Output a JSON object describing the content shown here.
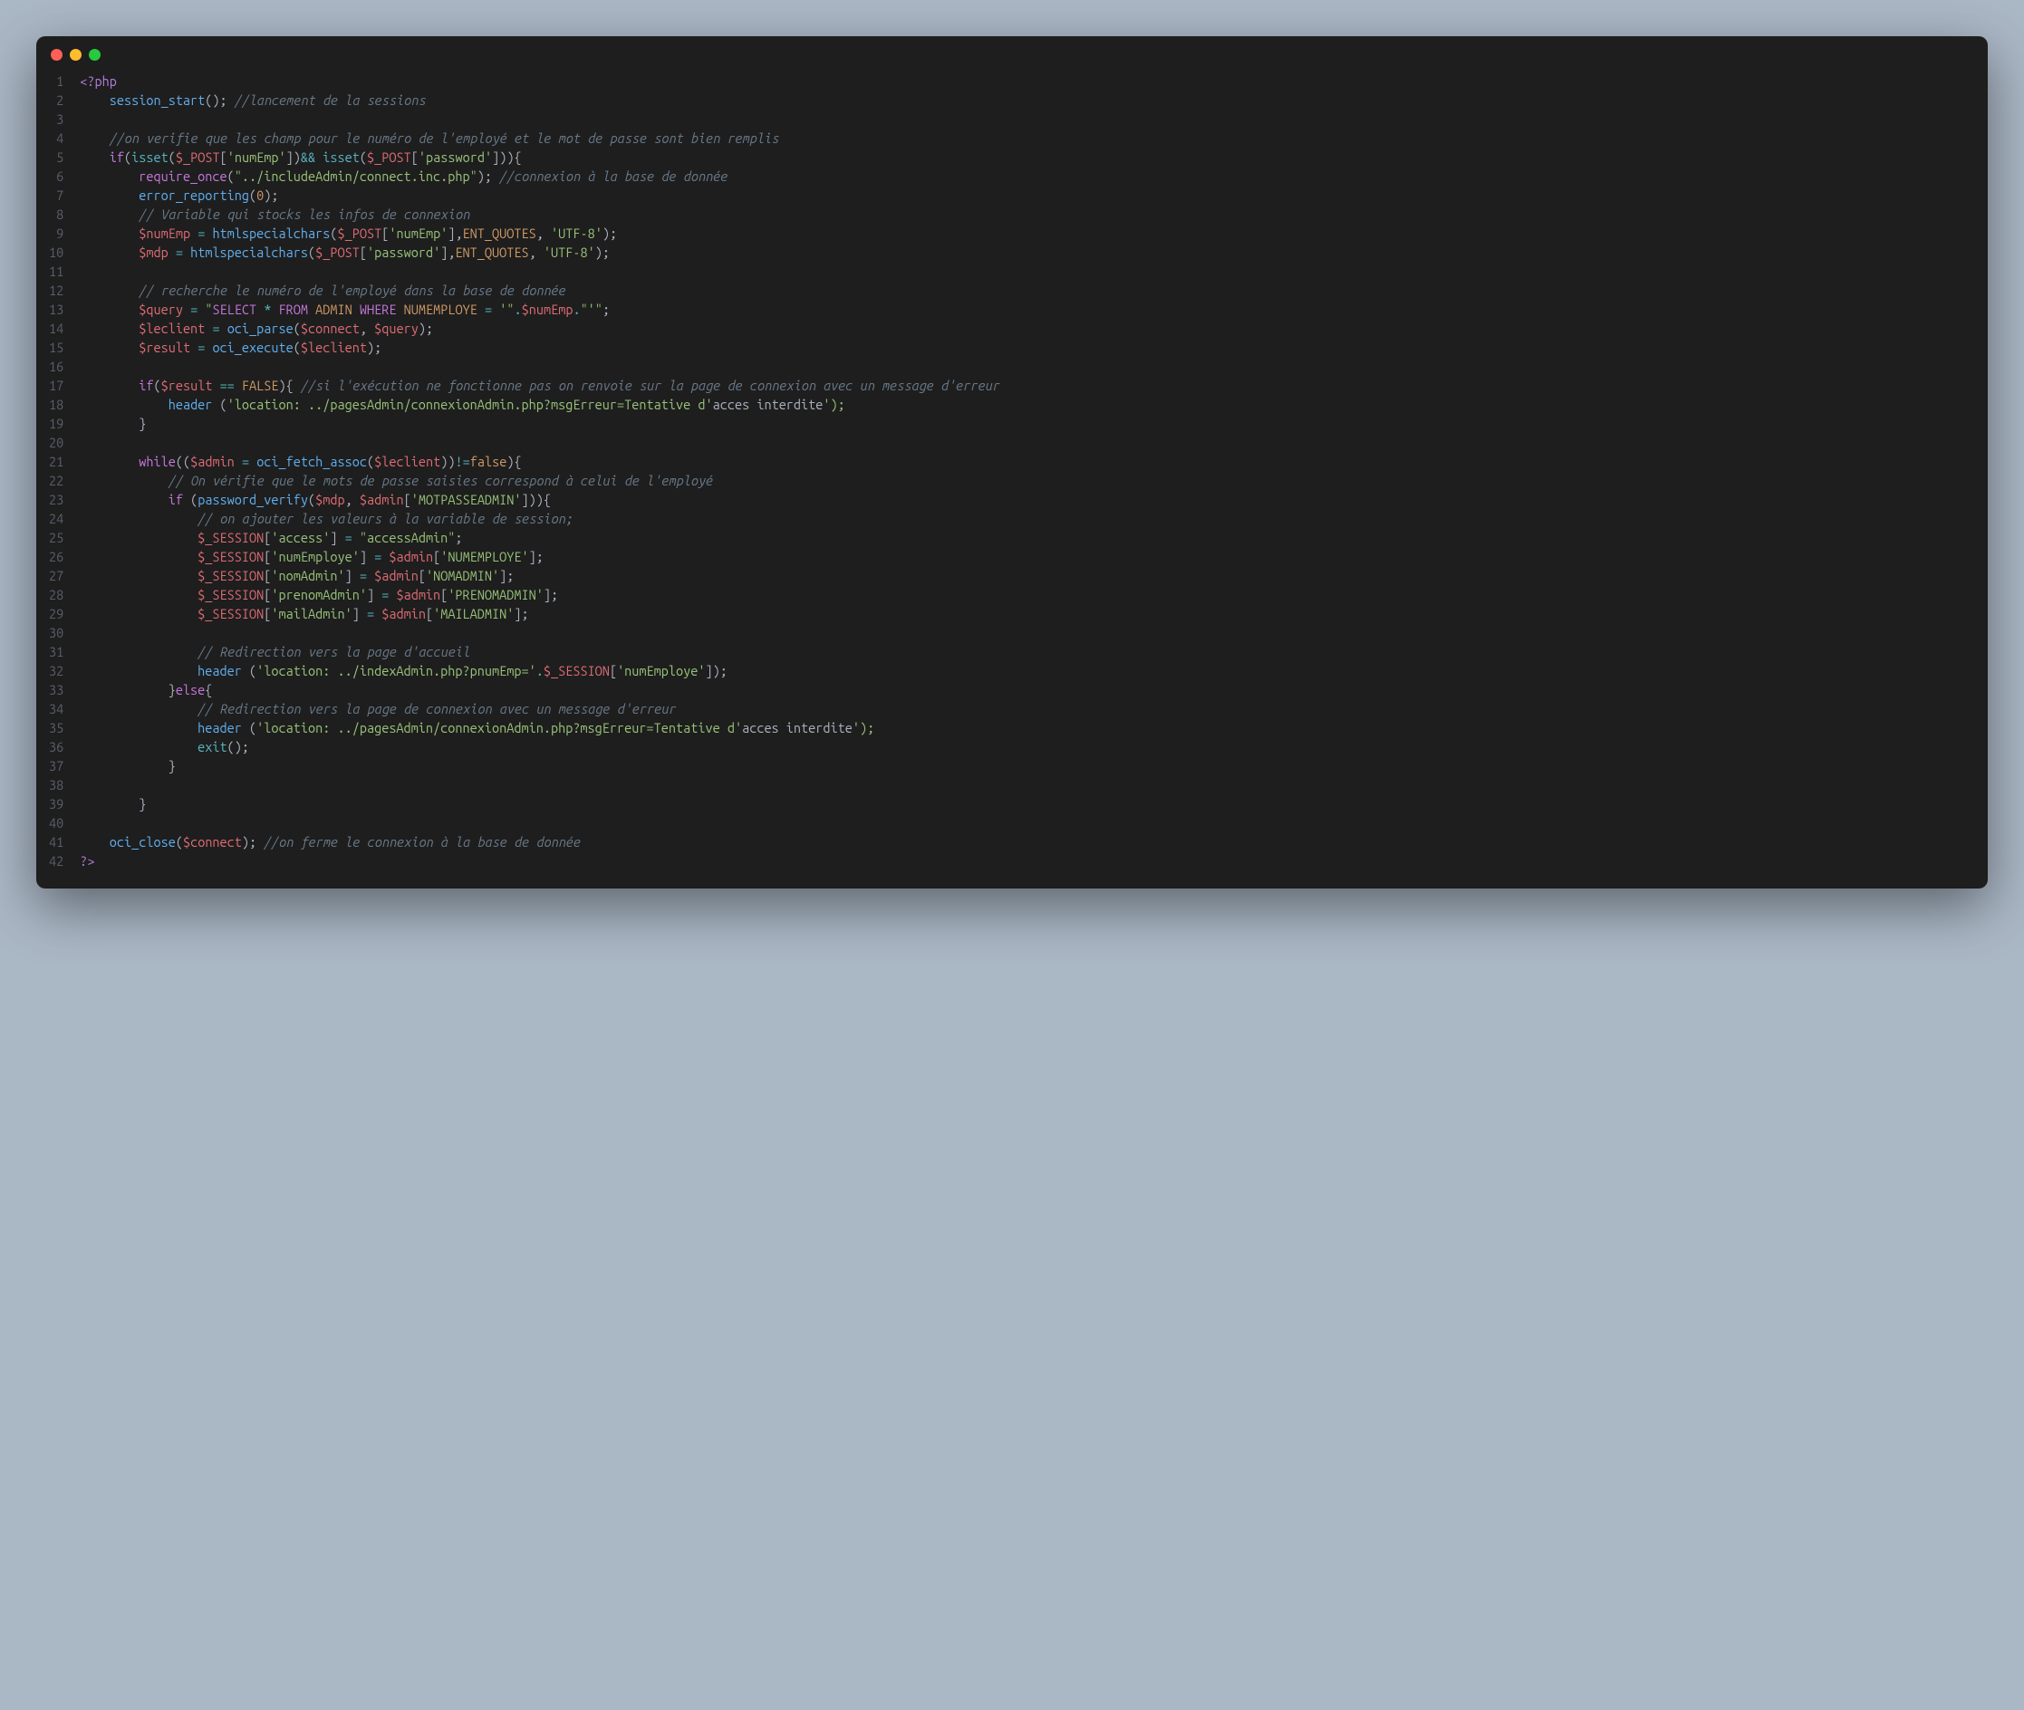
{
  "window": {
    "dot_colors": {
      "red": "#ff5f56",
      "yellow": "#ffbd2e",
      "green": "#27c93f"
    }
  },
  "code": {
    "line_count": 42,
    "tokens": [
      [
        [
          "c-tag",
          "<?php"
        ]
      ],
      [
        [
          "c-punc",
          "    "
        ],
        [
          "c-func",
          "session_start"
        ],
        [
          "c-punc",
          "(); "
        ],
        [
          "c-comment",
          "//lancement de la sessions"
        ]
      ],
      [],
      [
        [
          "c-punc",
          "    "
        ],
        [
          "c-comment",
          "//on verifie que les champ pour le numéro de l'employé et le mot de passe sont bien remplis"
        ]
      ],
      [
        [
          "c-punc",
          "    "
        ],
        [
          "c-keyword",
          "if"
        ],
        [
          "c-punc",
          "("
        ],
        [
          "c-builtin",
          "isset"
        ],
        [
          "c-punc",
          "("
        ],
        [
          "c-var",
          "$_POST"
        ],
        [
          "c-punc",
          "["
        ],
        [
          "c-str",
          "'numEmp'"
        ],
        [
          "c-punc",
          "])"
        ],
        [
          "c-op",
          "&&"
        ],
        [
          "c-punc",
          " "
        ],
        [
          "c-builtin",
          "isset"
        ],
        [
          "c-punc",
          "("
        ],
        [
          "c-var",
          "$_POST"
        ],
        [
          "c-punc",
          "["
        ],
        [
          "c-str",
          "'password'"
        ],
        [
          "c-punc",
          "])){"
        ]
      ],
      [
        [
          "c-punc",
          "        "
        ],
        [
          "c-keyword",
          "require_once"
        ],
        [
          "c-punc",
          "("
        ],
        [
          "c-str",
          "\"../includeAdmin/connect.inc.php\""
        ],
        [
          "c-punc",
          "); "
        ],
        [
          "c-comment",
          "//connexion à la base de donnée"
        ]
      ],
      [
        [
          "c-punc",
          "        "
        ],
        [
          "c-func",
          "error_reporting"
        ],
        [
          "c-punc",
          "("
        ],
        [
          "c-const",
          "0"
        ],
        [
          "c-punc",
          ");"
        ]
      ],
      [
        [
          "c-punc",
          "        "
        ],
        [
          "c-comment",
          "// Variable qui stocks les infos de connexion"
        ]
      ],
      [
        [
          "c-punc",
          "        "
        ],
        [
          "c-var",
          "$numEmp"
        ],
        [
          "c-punc",
          " "
        ],
        [
          "c-op",
          "="
        ],
        [
          "c-punc",
          " "
        ],
        [
          "c-func",
          "htmlspecialchars"
        ],
        [
          "c-punc",
          "("
        ],
        [
          "c-var",
          "$_POST"
        ],
        [
          "c-punc",
          "["
        ],
        [
          "c-str",
          "'numEmp'"
        ],
        [
          "c-punc",
          "],"
        ],
        [
          "c-const",
          "ENT_QUOTES"
        ],
        [
          "c-punc",
          ", "
        ],
        [
          "c-str",
          "'UTF-8'"
        ],
        [
          "c-punc",
          ");"
        ]
      ],
      [
        [
          "c-punc",
          "        "
        ],
        [
          "c-var",
          "$mdp"
        ],
        [
          "c-punc",
          " "
        ],
        [
          "c-op",
          "="
        ],
        [
          "c-punc",
          " "
        ],
        [
          "c-func",
          "htmlspecialchars"
        ],
        [
          "c-punc",
          "("
        ],
        [
          "c-var",
          "$_POST"
        ],
        [
          "c-punc",
          "["
        ],
        [
          "c-str",
          "'password'"
        ],
        [
          "c-punc",
          "],"
        ],
        [
          "c-const",
          "ENT_QUOTES"
        ],
        [
          "c-punc",
          ", "
        ],
        [
          "c-str",
          "'UTF-8'"
        ],
        [
          "c-punc",
          ");"
        ]
      ],
      [],
      [
        [
          "c-punc",
          "        "
        ],
        [
          "c-comment",
          "// recherche le numéro de l'employé dans la base de donnée"
        ]
      ],
      [
        [
          "c-punc",
          "        "
        ],
        [
          "c-var",
          "$query"
        ],
        [
          "c-punc",
          " "
        ],
        [
          "c-op",
          "="
        ],
        [
          "c-punc",
          " "
        ],
        [
          "c-str",
          "\""
        ],
        [
          "c-keyword",
          "SELECT"
        ],
        [
          "c-str",
          " "
        ],
        [
          "c-op",
          "*"
        ],
        [
          "c-str",
          " "
        ],
        [
          "c-keyword",
          "FROM"
        ],
        [
          "c-str",
          " "
        ],
        [
          "c-const",
          "ADMIN"
        ],
        [
          "c-str",
          " "
        ],
        [
          "c-keyword",
          "WHERE"
        ],
        [
          "c-str",
          " "
        ],
        [
          "c-const",
          "NUMEMPLOYE"
        ],
        [
          "c-str",
          " "
        ],
        [
          "c-op",
          "="
        ],
        [
          "c-str",
          " '\""
        ],
        [
          "c-op",
          "."
        ],
        [
          "c-var",
          "$numEmp"
        ],
        [
          "c-op",
          "."
        ],
        [
          "c-str",
          "\"'\""
        ],
        [
          "c-punc",
          ";"
        ]
      ],
      [
        [
          "c-punc",
          "        "
        ],
        [
          "c-var",
          "$leclient"
        ],
        [
          "c-punc",
          " "
        ],
        [
          "c-op",
          "="
        ],
        [
          "c-punc",
          " "
        ],
        [
          "c-func",
          "oci_parse"
        ],
        [
          "c-punc",
          "("
        ],
        [
          "c-var",
          "$connect"
        ],
        [
          "c-punc",
          ", "
        ],
        [
          "c-var",
          "$query"
        ],
        [
          "c-punc",
          ");"
        ]
      ],
      [
        [
          "c-punc",
          "        "
        ],
        [
          "c-var",
          "$result"
        ],
        [
          "c-punc",
          " "
        ],
        [
          "c-op",
          "="
        ],
        [
          "c-punc",
          " "
        ],
        [
          "c-func",
          "oci_execute"
        ],
        [
          "c-punc",
          "("
        ],
        [
          "c-var",
          "$leclient"
        ],
        [
          "c-punc",
          ");"
        ]
      ],
      [],
      [
        [
          "c-punc",
          "        "
        ],
        [
          "c-keyword",
          "if"
        ],
        [
          "c-punc",
          "("
        ],
        [
          "c-var",
          "$result"
        ],
        [
          "c-punc",
          " "
        ],
        [
          "c-op",
          "=="
        ],
        [
          "c-punc",
          " "
        ],
        [
          "c-const",
          "FALSE"
        ],
        [
          "c-punc",
          "){ "
        ],
        [
          "c-comment",
          "//si l'exécution ne fonctionne pas on renvoie sur la page de connexion avec un message d'erreur"
        ]
      ],
      [
        [
          "c-punc",
          "            "
        ],
        [
          "c-func",
          "header"
        ],
        [
          "c-punc",
          " ("
        ],
        [
          "c-str",
          "'location: ../pagesAdmin/connexionAdmin.php?msgErreur=Tentative d'"
        ],
        [
          "c-punc",
          "acces interdite"
        ],
        [
          "c-str",
          "');"
        ]
      ],
      [
        [
          "c-punc",
          "        }"
        ]
      ],
      [],
      [
        [
          "c-punc",
          "        "
        ],
        [
          "c-keyword",
          "while"
        ],
        [
          "c-punc",
          "(("
        ],
        [
          "c-var",
          "$admin"
        ],
        [
          "c-punc",
          " "
        ],
        [
          "c-op",
          "="
        ],
        [
          "c-punc",
          " "
        ],
        [
          "c-func",
          "oci_fetch_assoc"
        ],
        [
          "c-punc",
          "("
        ],
        [
          "c-var",
          "$leclient"
        ],
        [
          "c-punc",
          "))"
        ],
        [
          "c-op",
          "!="
        ],
        [
          "c-const",
          "false"
        ],
        [
          "c-punc",
          "){"
        ]
      ],
      [
        [
          "c-punc",
          "            "
        ],
        [
          "c-comment",
          "// On vérifie que le mots de passe saisies correspond à celui de l'employé"
        ]
      ],
      [
        [
          "c-punc",
          "            "
        ],
        [
          "c-keyword",
          "if"
        ],
        [
          "c-punc",
          " ("
        ],
        [
          "c-func",
          "password_verify"
        ],
        [
          "c-punc",
          "("
        ],
        [
          "c-var",
          "$mdp"
        ],
        [
          "c-punc",
          ", "
        ],
        [
          "c-var",
          "$admin"
        ],
        [
          "c-punc",
          "["
        ],
        [
          "c-str",
          "'MOTPASSEADMIN'"
        ],
        [
          "c-punc",
          "])){"
        ]
      ],
      [
        [
          "c-punc",
          "                "
        ],
        [
          "c-comment",
          "// on ajouter les valeurs à la variable de session;"
        ]
      ],
      [
        [
          "c-punc",
          "                "
        ],
        [
          "c-var",
          "$_SESSION"
        ],
        [
          "c-punc",
          "["
        ],
        [
          "c-str",
          "'access'"
        ],
        [
          "c-punc",
          "] "
        ],
        [
          "c-op",
          "="
        ],
        [
          "c-punc",
          " "
        ],
        [
          "c-str",
          "\"accessAdmin\""
        ],
        [
          "c-punc",
          ";"
        ]
      ],
      [
        [
          "c-punc",
          "                "
        ],
        [
          "c-var",
          "$_SESSION"
        ],
        [
          "c-punc",
          "["
        ],
        [
          "c-str",
          "'numEmploye'"
        ],
        [
          "c-punc",
          "] "
        ],
        [
          "c-op",
          "="
        ],
        [
          "c-punc",
          " "
        ],
        [
          "c-var",
          "$admin"
        ],
        [
          "c-punc",
          "["
        ],
        [
          "c-str",
          "'NUMEMPLOYE'"
        ],
        [
          "c-punc",
          "];"
        ]
      ],
      [
        [
          "c-punc",
          "                "
        ],
        [
          "c-var",
          "$_SESSION"
        ],
        [
          "c-punc",
          "["
        ],
        [
          "c-str",
          "'nomAdmin'"
        ],
        [
          "c-punc",
          "] "
        ],
        [
          "c-op",
          "="
        ],
        [
          "c-punc",
          " "
        ],
        [
          "c-var",
          "$admin"
        ],
        [
          "c-punc",
          "["
        ],
        [
          "c-str",
          "'NOMADMIN'"
        ],
        [
          "c-punc",
          "];"
        ]
      ],
      [
        [
          "c-punc",
          "                "
        ],
        [
          "c-var",
          "$_SESSION"
        ],
        [
          "c-punc",
          "["
        ],
        [
          "c-str",
          "'prenomAdmin'"
        ],
        [
          "c-punc",
          "] "
        ],
        [
          "c-op",
          "="
        ],
        [
          "c-punc",
          " "
        ],
        [
          "c-var",
          "$admin"
        ],
        [
          "c-punc",
          "["
        ],
        [
          "c-str",
          "'PRENOMADMIN'"
        ],
        [
          "c-punc",
          "];"
        ]
      ],
      [
        [
          "c-punc",
          "                "
        ],
        [
          "c-var",
          "$_SESSION"
        ],
        [
          "c-punc",
          "["
        ],
        [
          "c-str",
          "'mailAdmin'"
        ],
        [
          "c-punc",
          "] "
        ],
        [
          "c-op",
          "="
        ],
        [
          "c-punc",
          " "
        ],
        [
          "c-var",
          "$admin"
        ],
        [
          "c-punc",
          "["
        ],
        [
          "c-str",
          "'MAILADMIN'"
        ],
        [
          "c-punc",
          "];"
        ]
      ],
      [],
      [
        [
          "c-punc",
          "                "
        ],
        [
          "c-comment",
          "// Redirection vers la page d'accueil"
        ]
      ],
      [
        [
          "c-punc",
          "                "
        ],
        [
          "c-func",
          "header"
        ],
        [
          "c-punc",
          " ("
        ],
        [
          "c-str",
          "'location: ../indexAdmin.php?pnumEmp='"
        ],
        [
          "c-op",
          "."
        ],
        [
          "c-var",
          "$_SESSION"
        ],
        [
          "c-punc",
          "["
        ],
        [
          "c-str",
          "'numEmploye'"
        ],
        [
          "c-punc",
          "]);"
        ]
      ],
      [
        [
          "c-punc",
          "            }"
        ],
        [
          "c-keyword",
          "else"
        ],
        [
          "c-punc",
          "{"
        ]
      ],
      [
        [
          "c-punc",
          "                "
        ],
        [
          "c-comment",
          "// Redirection vers la page de connexion avec un message d'erreur"
        ]
      ],
      [
        [
          "c-punc",
          "                "
        ],
        [
          "c-func",
          "header"
        ],
        [
          "c-punc",
          " ("
        ],
        [
          "c-str",
          "'location: ../pagesAdmin/connexionAdmin.php?msgErreur=Tentative d'"
        ],
        [
          "c-punc",
          "acces interdite"
        ],
        [
          "c-str",
          "');"
        ]
      ],
      [
        [
          "c-punc",
          "                "
        ],
        [
          "c-builtin",
          "exit"
        ],
        [
          "c-punc",
          "();"
        ]
      ],
      [
        [
          "c-punc",
          "            }"
        ]
      ],
      [],
      [
        [
          "c-punc",
          "        }"
        ]
      ],
      [],
      [
        [
          "c-punc",
          "    "
        ],
        [
          "c-func",
          "oci_close"
        ],
        [
          "c-punc",
          "("
        ],
        [
          "c-var",
          "$connect"
        ],
        [
          "c-punc",
          "); "
        ],
        [
          "c-comment",
          "//on ferme le connexion à la base de donnée"
        ]
      ],
      [
        [
          "c-tag",
          "?>"
        ]
      ]
    ]
  }
}
